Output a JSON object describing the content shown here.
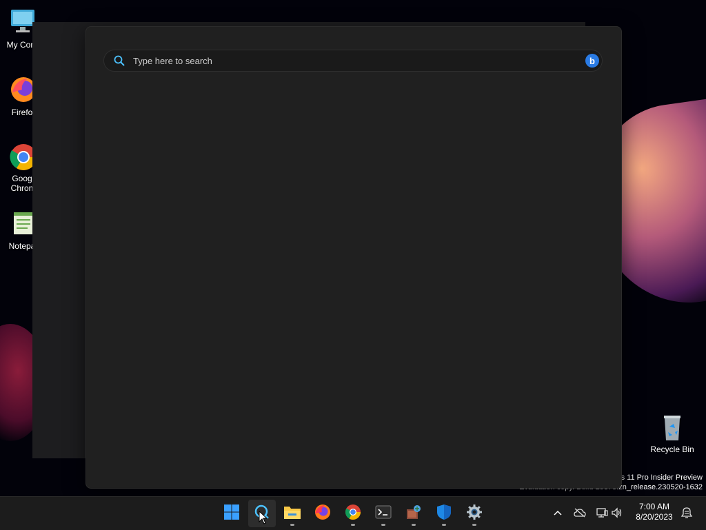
{
  "desktop": {
    "icons": [
      {
        "label": "My Com",
        "icon": "computer-icon"
      },
      {
        "label": "Firefo",
        "icon": "firefox-icon"
      },
      {
        "label": "Goog",
        "label2": "Chron",
        "icon": "chrome-icon"
      },
      {
        "label": "Notepa",
        "icon": "notepad-icon"
      }
    ],
    "recycle_bin": {
      "label": "Recycle Bin",
      "icon": "recycle-bin-icon"
    },
    "watermark": {
      "line1": "s 11 Pro Insider Preview",
      "line2": "Evaluation copy. Build 25375.zn_release.230520-1632"
    }
  },
  "search": {
    "placeholder": "Type here to search",
    "bing_label": "b"
  },
  "taskbar": {
    "apps": [
      {
        "name": "start",
        "icon": "windows-start-icon"
      },
      {
        "name": "search",
        "icon": "search-icon"
      },
      {
        "name": "file-explorer",
        "icon": "folder-icon"
      },
      {
        "name": "firefox",
        "icon": "firefox-icon"
      },
      {
        "name": "chrome",
        "icon": "chrome-icon"
      },
      {
        "name": "terminal",
        "icon": "terminal-icon"
      },
      {
        "name": "app",
        "icon": "app-icon"
      },
      {
        "name": "defender",
        "icon": "shield-icon"
      },
      {
        "name": "settings",
        "icon": "gear-icon"
      }
    ],
    "tray": {
      "time": "7:00 AM",
      "date": "8/20/2023"
    }
  },
  "colors": {
    "accent": "#2a7be4",
    "panel": "#202020",
    "taskbar": "#1c1c1c"
  }
}
